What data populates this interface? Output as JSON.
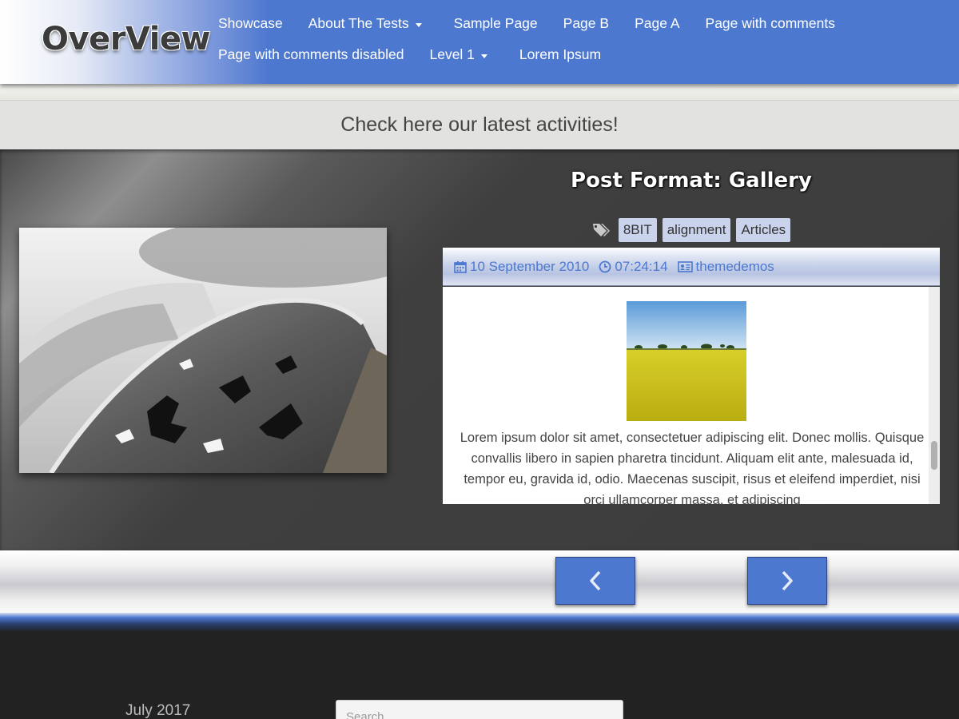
{
  "header": {
    "logo": "OverView",
    "nav_row1": [
      {
        "label": "Showcase",
        "dropdown": false
      },
      {
        "label": "About The Tests",
        "dropdown": true
      },
      {
        "label": "Sample Page",
        "dropdown": false
      },
      {
        "label": "Page B",
        "dropdown": false
      },
      {
        "label": "Page A",
        "dropdown": false
      },
      {
        "label": "Page with comments",
        "dropdown": false
      }
    ],
    "nav_row2": [
      {
        "label": "Page with comments disabled",
        "dropdown": false
      },
      {
        "label": "Level 1",
        "dropdown": true
      },
      {
        "label": "Lorem Ipsum",
        "dropdown": false
      }
    ]
  },
  "band": {
    "text": "Check here our latest activities!"
  },
  "slide": {
    "title": "Post Format: Gallery",
    "tags": [
      "8BIT",
      "alignment",
      "Articles"
    ],
    "meta": {
      "date": "10 September 2010",
      "time": "07:24:14",
      "author": "themedemos"
    },
    "excerpt": "Lorem ipsum dolor sit amet, consectetuer adipiscing elit. Donec mollis. Quisque convallis libero in sapien pharetra tincidunt. Aliquam elit ante, malesuada id, tempor eu, gravida id, odio. Maecenas suscipit, risus et eleifend imperdiet, nisi orci ullamcorper massa, et adipiscing"
  },
  "footer": {
    "archive_date": "July 2017",
    "search_placeholder": "Search ..."
  },
  "colors": {
    "accent": "#4d78cf",
    "tag_bg": "#c9d3ec",
    "footer_bg": "#222222"
  }
}
